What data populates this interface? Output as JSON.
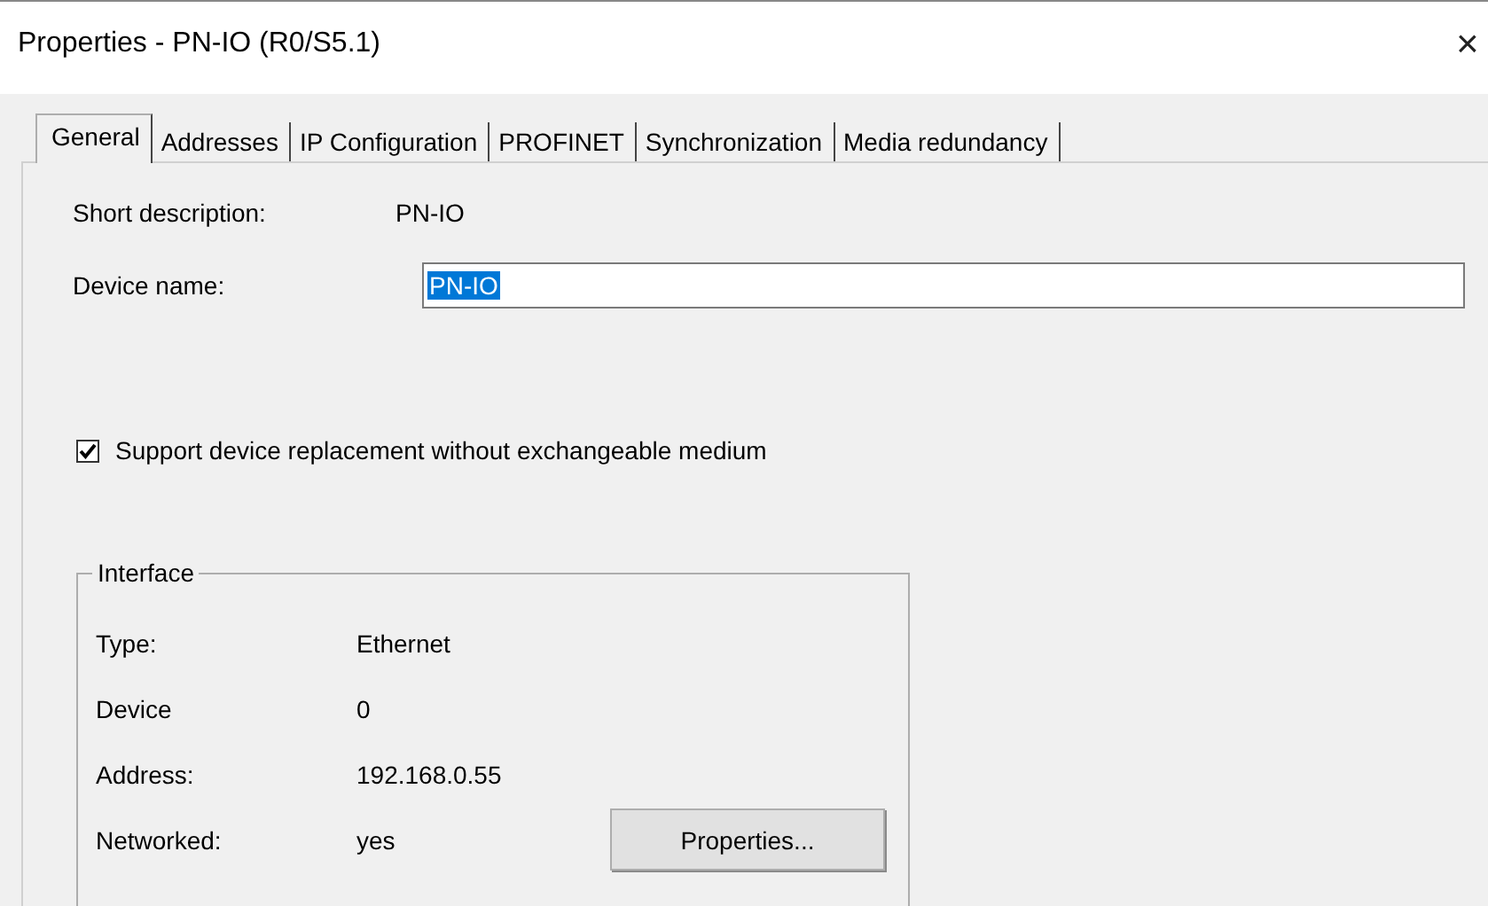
{
  "window": {
    "title": "Properties - PN-IO (R0/S5.1)",
    "close": "×"
  },
  "tabs": [
    {
      "label": "General",
      "selected": true
    },
    {
      "label": "Addresses",
      "selected": false
    },
    {
      "label": "IP Configuration",
      "selected": false
    },
    {
      "label": "PROFINET",
      "selected": false
    },
    {
      "label": "Synchronization",
      "selected": false
    },
    {
      "label": "Media redundancy",
      "selected": false
    }
  ],
  "general": {
    "short_description": {
      "label": "Short description:",
      "value": "PN-IO"
    },
    "device_name": {
      "label": "Device name:",
      "value": "PN-IO",
      "text_selected": true
    },
    "device_replacement": {
      "label": "Support device replacement without exchangeable medium",
      "checked": true
    }
  },
  "interface": {
    "title": "Interface",
    "rows": [
      {
        "label": "Type:",
        "value": "Ethernet"
      },
      {
        "label": "Device",
        "value": "0"
      },
      {
        "label": "Address:",
        "value": "192.168.0.55"
      },
      {
        "label": "Networked:",
        "value": "yes"
      }
    ],
    "button": "Properties..."
  }
}
